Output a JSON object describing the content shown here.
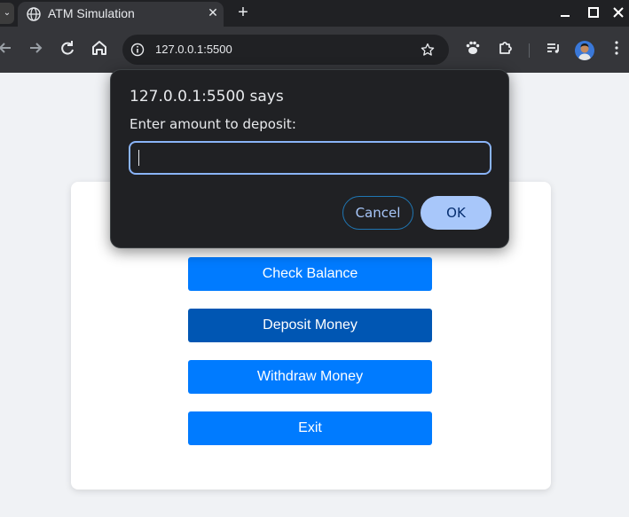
{
  "browser": {
    "tab_title": "ATM Simulation",
    "url": "127.0.0.1:5500"
  },
  "dialog": {
    "title": "127.0.0.1:5500 says",
    "message": "Enter amount to deposit:",
    "input_value": "",
    "cancel_label": "Cancel",
    "ok_label": "OK"
  },
  "menu": {
    "items": [
      {
        "label": "Check Balance"
      },
      {
        "label": "Deposit Money"
      },
      {
        "label": "Withdraw Money"
      },
      {
        "label": "Exit"
      }
    ]
  },
  "colors": {
    "button": "#007bff",
    "button_active": "#0056b3",
    "dialog_bg": "#202124",
    "ok_bg": "#a8c7fa"
  }
}
